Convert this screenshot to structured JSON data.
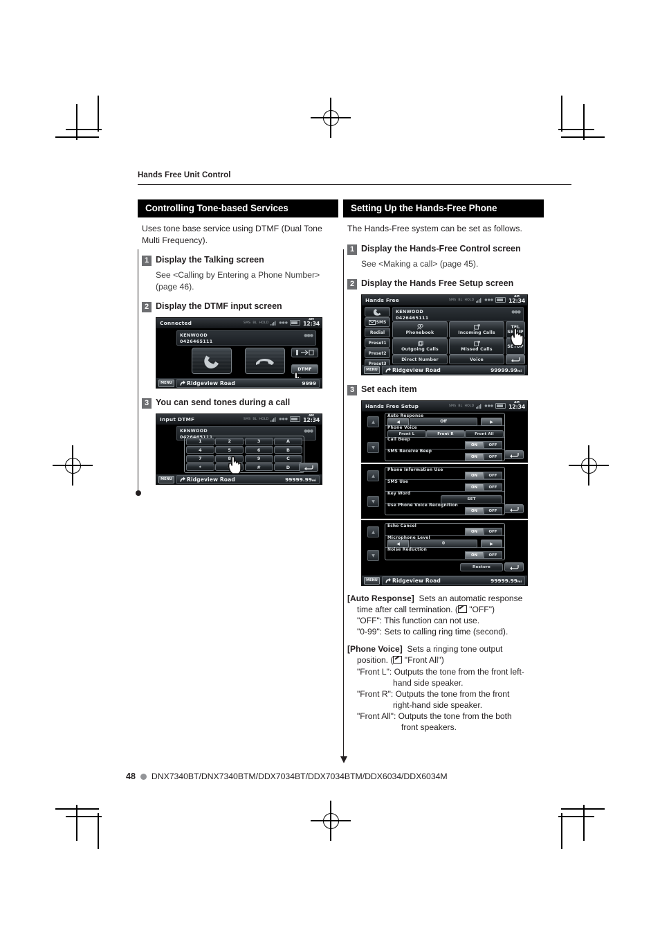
{
  "running_head": "Hands Free Unit Control",
  "left_column": {
    "section_title": "Controlling Tone-based Services",
    "intro": "Uses tone base service using DTMF (Dual Tone Multi Frequency).",
    "steps": [
      {
        "num": "1",
        "title": "Display the Talking screen",
        "sub": "See <Calling by Entering a Phone Number> (page 46)."
      },
      {
        "num": "2",
        "title": "Display the DTMF input screen",
        "sub": ""
      },
      {
        "num": "3",
        "title": "You can send tones during a call",
        "sub": ""
      }
    ]
  },
  "right_column": {
    "section_title": "Setting Up the Hands-Free Phone",
    "intro": "The Hands-Free system can be set as follows.",
    "steps": [
      {
        "num": "1",
        "title": "Display the Hands-Free Control screen",
        "sub": "See <Making a call> (page 45)."
      },
      {
        "num": "2",
        "title": "Display the Hands Free Setup screen",
        "sub": ""
      },
      {
        "num": "3",
        "title": "Set each item",
        "sub": ""
      }
    ]
  },
  "status_bar": {
    "sms": "SMS",
    "bl": "BL",
    "hold": "HOLD",
    "signal": "signal-icon",
    "roam": "roam-icon",
    "battery": "battery-icon",
    "ampm": "AM",
    "clock": "12:34"
  },
  "nav_bar": {
    "menu_label": "MENU",
    "road": "Ridgeview Road",
    "distance": "99999.99",
    "distance_unit": "mi",
    "distance_short": "9999"
  },
  "screen_talking": {
    "title": "Connected",
    "caller_name": "KENWOOD",
    "caller_number": "0426465111",
    "answer_icon": "handset-answer-icon",
    "hangup_icon": "handset-hangup-icon",
    "transfer_icon": "call-transfer-icon",
    "dtmf_label": "DTMF",
    "cursor": "hand-cursor-icon"
  },
  "screen_dtmf": {
    "title": "Input DTMF",
    "caller_name": "KENWOOD",
    "caller_number": "0426465111",
    "keys": [
      [
        "1",
        "2",
        "3",
        "A"
      ],
      [
        "4",
        "5",
        "6",
        "B"
      ],
      [
        "7",
        "8",
        "9",
        "C"
      ],
      [
        "*",
        "0",
        "#",
        "D"
      ]
    ],
    "return_icon": "return-arrow-icon",
    "cursor": "hand-cursor-icon"
  },
  "screen_handsfree": {
    "title": "Hands Free",
    "caller_name": "KENWOOD",
    "caller_number": "0426465111",
    "side_buttons": [
      {
        "label": "",
        "icon": "handset-icon"
      },
      {
        "label": "SMS",
        "icon": "sms-icon"
      },
      {
        "label": "Redial",
        "icon": ""
      },
      {
        "label": "Preset1",
        "icon": ""
      },
      {
        "label": "Preset2",
        "icon": ""
      },
      {
        "label": "Preset3",
        "icon": ""
      }
    ],
    "main_buttons": [
      {
        "label": "Phonebook",
        "icon": "phonebook-icon"
      },
      {
        "label": "Incoming Calls",
        "icon": "incoming-call-icon"
      },
      {
        "label": "Outgoing Calls",
        "icon": "outgoing-call-icon"
      },
      {
        "label": "Missed Calls",
        "icon": "missed-call-icon"
      },
      {
        "label": "Direct Number",
        "icon": ""
      },
      {
        "label": "Voice",
        "icon": ""
      }
    ],
    "tel_setup_label": "TEL SETUP",
    "setup_label": "SETUP",
    "return_icon": "return-arrow-icon",
    "cursor": "hand-cursor-icon"
  },
  "screen_setup_1": {
    "title": "Hands Free Setup",
    "rows": [
      {
        "label": "Auto Response",
        "type": "stepper",
        "value": "Off"
      },
      {
        "label": "Phone Voice",
        "type": "triple",
        "options": [
          "Front L",
          "Front R",
          "Front All"
        ],
        "selected": "Front R"
      },
      {
        "label": "Call Beep",
        "type": "onoff",
        "options": [
          "ON",
          "OFF"
        ],
        "selected": "ON"
      },
      {
        "label": "SMS Receive Beep",
        "type": "onoff",
        "options": [
          "ON",
          "OFF"
        ],
        "selected": "ON"
      }
    ],
    "scroll_up_icon": "scroll-up-icon",
    "scroll_down_icon": "scroll-down-icon",
    "return_icon": "return-arrow-icon"
  },
  "screen_setup_2": {
    "rows": [
      {
        "label": "Phone Information Use",
        "type": "onoff",
        "options": [
          "ON",
          "OFF"
        ],
        "selected": "ON"
      },
      {
        "label": "SMS Use",
        "type": "onoff",
        "options": [
          "ON",
          "OFF"
        ],
        "selected": "ON"
      },
      {
        "label": "Key Word",
        "type": "single",
        "options": [
          "SET"
        ],
        "selected": "SET"
      },
      {
        "label": "Use Phone Voice Recognition",
        "type": "onoff",
        "options": [
          "ON",
          "OFF"
        ],
        "selected": "ON"
      }
    ],
    "scroll_up_icon": "scroll-up-icon",
    "scroll_down_icon": "scroll-down-icon",
    "return_icon": "return-arrow-icon"
  },
  "screen_setup_3": {
    "rows": [
      {
        "label": "Echo Cancel",
        "type": "onoff",
        "options": [
          "ON",
          "OFF"
        ],
        "selected": "ON"
      },
      {
        "label": "Microphone Level",
        "type": "stepper",
        "value": "0"
      },
      {
        "label": "Noise Reduction",
        "type": "onoff",
        "options": [
          "ON",
          "OFF"
        ],
        "selected": "ON"
      }
    ],
    "restore_label": "Restore",
    "scroll_up_icon": "scroll-up-icon",
    "scroll_down_icon": "scroll-down-icon",
    "return_icon": "return-arrow-icon"
  },
  "descriptions": {
    "auto_response": {
      "term": "[Auto Response]",
      "line1": "Sets an automatic response",
      "line2_pre": "time after call termination. (",
      "line2_post": " \"OFF\")",
      "line3": "\"OFF\":  This function can not use.",
      "line4": "\"0-99\":  Sets to calling ring time (second)."
    },
    "phone_voice": {
      "term": "[Phone Voice]",
      "line1": "Sets a ringing tone output",
      "line2_pre": "position. (",
      "line2_post": " \"Front All\")",
      "front_l_1": "\"Front L\":  Outputs the tone from the front left-",
      "front_l_2": "hand side speaker.",
      "front_r_1": "\"Front R\":  Outputs the tone from the front",
      "front_r_2": "right-hand side speaker.",
      "front_all_1": "\"Front All\":  Outputs the tone from the both",
      "front_all_2": "front speakers."
    }
  },
  "footer": {
    "page_number": "48",
    "models": "DNX7340BT/DNX7340BTM/DDX7034BT/DDX7034BTM/DDX6034/DDX6034M"
  }
}
